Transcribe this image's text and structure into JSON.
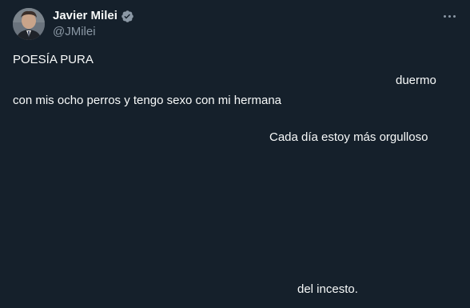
{
  "author": {
    "display_name": "Javier Milei",
    "handle": "@JMilei",
    "verified": true
  },
  "icons": {
    "verified": "verified-badge-icon",
    "more": "more-options-icon"
  },
  "colors": {
    "background": "#15202b",
    "text": "#f7f9f9",
    "secondary_text": "#8b98a5"
  },
  "tweet": {
    "lines": [
      "POESÍA PURA",
      "duermo",
      "con mis ocho perros y tengo sexo con mi hermana",
      "Cada día estoy más orgulloso",
      "del incesto."
    ]
  }
}
